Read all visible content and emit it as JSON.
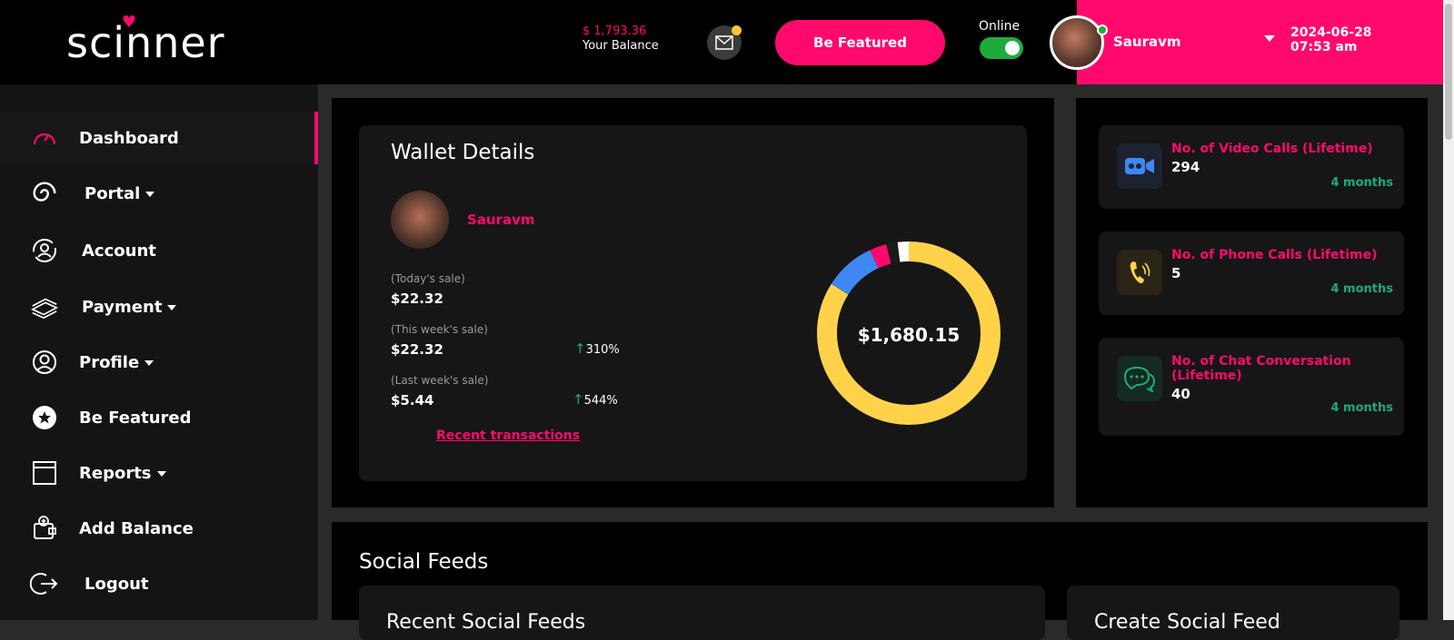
{
  "header": {
    "logo": "scinner",
    "balance_amount": "$ 1,793.36",
    "balance_label": "Your Balance",
    "feature_button": "Be Featured",
    "online_label": "Online",
    "online": true,
    "user_name": "Sauravm",
    "date": "2024-06-28",
    "time": "07:53 am"
  },
  "sidebar": {
    "items": [
      {
        "label": "Dashboard",
        "icon": "gauge-icon",
        "active": true
      },
      {
        "label": "Portal",
        "icon": "spiral-icon",
        "dropdown": true
      },
      {
        "label": "Account",
        "icon": "user-sync-icon"
      },
      {
        "label": "Payment",
        "icon": "cash-stack-icon",
        "dropdown": true
      },
      {
        "label": "Profile",
        "icon": "user-circle-icon",
        "dropdown": true
      },
      {
        "label": "Be Featured",
        "icon": "star-badge-icon"
      },
      {
        "label": "Reports",
        "icon": "report-window-icon",
        "dropdown": true
      },
      {
        "label": "Add Balance",
        "icon": "wallet-add-icon"
      },
      {
        "label": "Logout",
        "icon": "logout-icon"
      }
    ]
  },
  "wallet": {
    "title": "Wallet Details",
    "user_name": "Sauravm",
    "today_label": "(Today's sale)",
    "today_value": "$22.32",
    "week_label": "(This week's sale)",
    "week_value": "$22.32",
    "week_change": "310%",
    "last_week_label": "(Last week's sale)",
    "last_week_value": "$5.44",
    "last_week_change": "544%",
    "recent_link": "Recent transactions",
    "total": "$1,680.15",
    "donut": [
      {
        "share": 0.84,
        "color": "#ffd24a"
      },
      {
        "share": 0.09,
        "color": "#3f87f5"
      },
      {
        "share": 0.03,
        "color": "#ff0a6c"
      },
      {
        "share": 0.02,
        "color": "#1b1b1b"
      },
      {
        "share": 0.02,
        "color": "#ffffff"
      }
    ]
  },
  "stats": [
    {
      "title": "No. of Video Calls (Lifetime)",
      "value": "294",
      "period": "4 months",
      "icon": "video-camera-icon"
    },
    {
      "title": "No. of Phone Calls (Lifetime)",
      "value": "5",
      "period": "4 months",
      "icon": "phone-icon"
    },
    {
      "title": "No. of Chat Conversation (Lifetime)",
      "value": "40",
      "period": "4 months",
      "icon": "chat-bubbles-icon"
    }
  ],
  "social": {
    "title": "Social Feeds",
    "recent_title": "Recent Social Feeds",
    "create_title": "Create Social Feed"
  },
  "colors": {
    "accent": "#ff0a6c",
    "green": "#1faa7a",
    "yellow": "#ffd24a",
    "blue": "#3f87f5"
  }
}
